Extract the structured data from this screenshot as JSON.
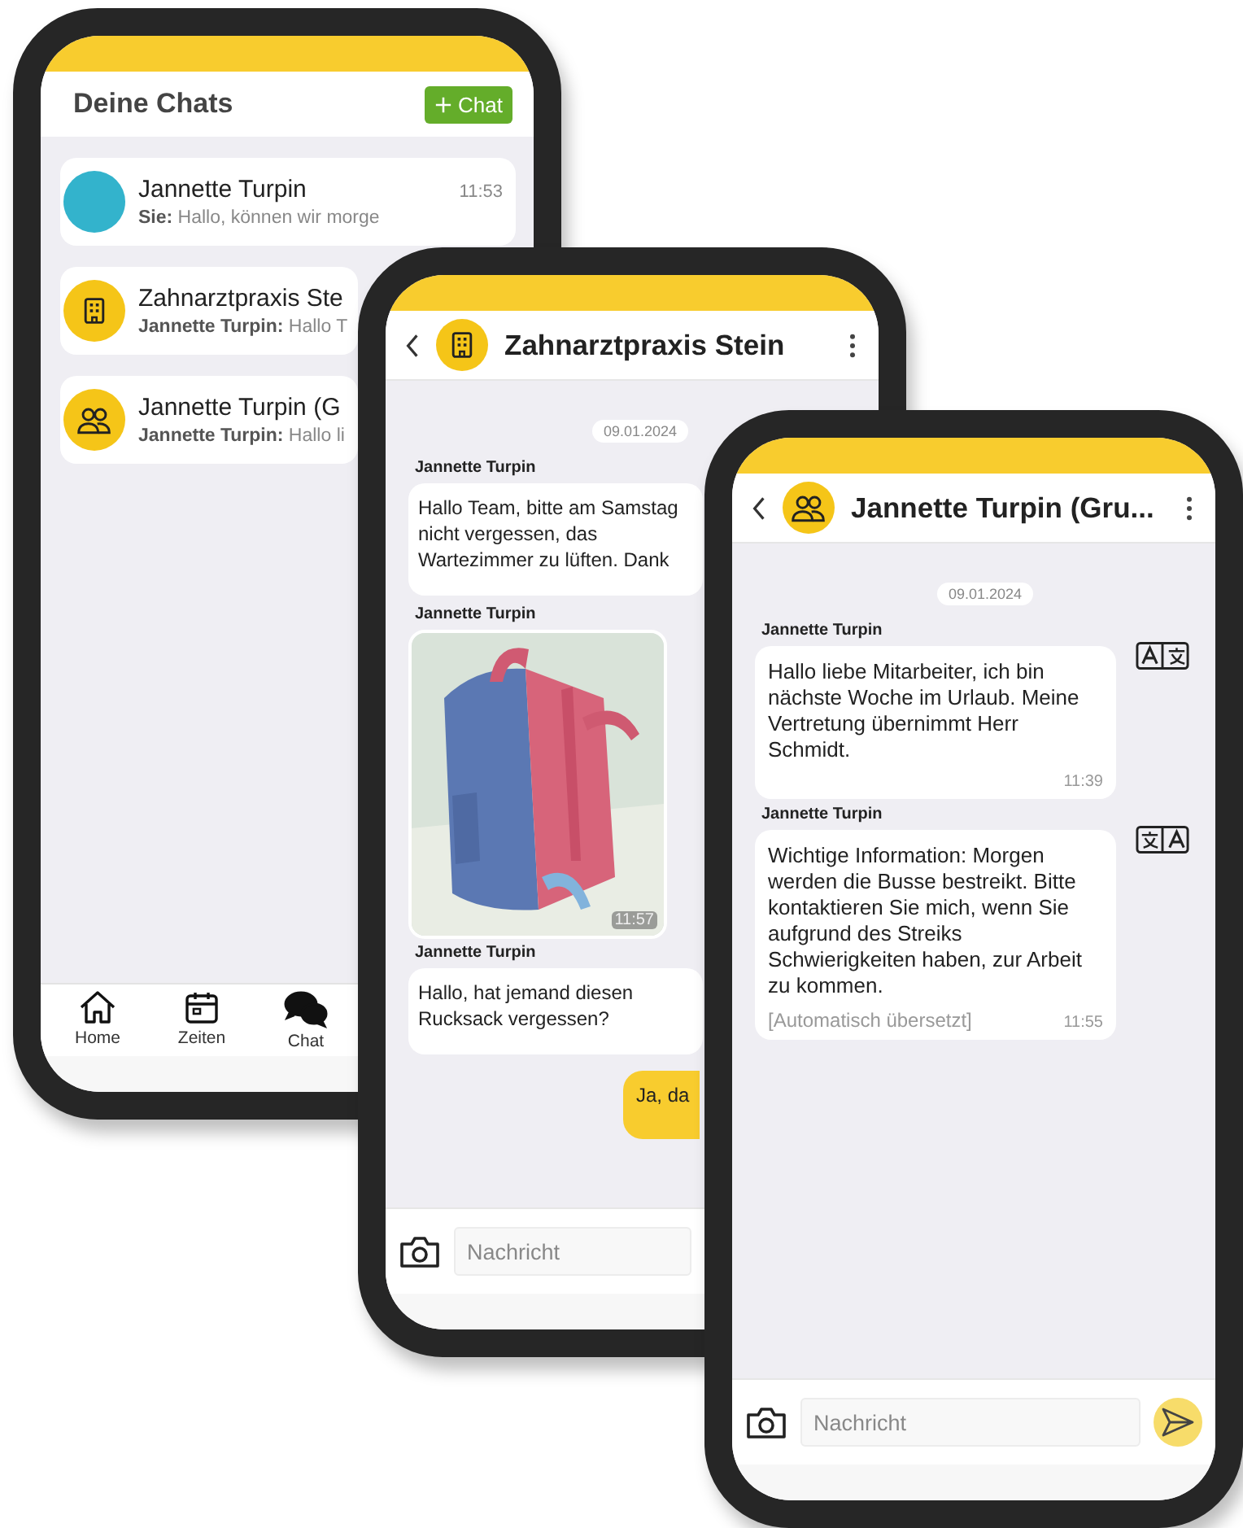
{
  "chat_list_screen": {
    "title": "Deine Chats",
    "new_chat_button": {
      "label": "Chat"
    },
    "chats": [
      {
        "kind": "person",
        "name": "Jannette Turpin",
        "time": "11:53",
        "preview": "**Sie:** Hallo, können wir morge"
      },
      {
        "kind": "building",
        "name": "Zahnarztpraxis Ste",
        "preview": "**Jannette Turpin:** Hallo T"
      },
      {
        "kind": "group",
        "name": "Jannette Turpin (G",
        "preview": "**Jannette Turpin:** Hallo li"
      }
    ],
    "nav": [
      {
        "kind": "home",
        "label": "Home",
        "selected": false
      },
      {
        "kind": "calendar",
        "label": "Zeiten",
        "selected": false
      },
      {
        "kind": "chat",
        "label": "Chat",
        "selected": true
      }
    ]
  },
  "company_chat_screen": {
    "title": "Zahnarztpraxis Stein",
    "avatar": {
      "kind": "building"
    },
    "date": "09.01.2024",
    "messages": [
      {
        "kind": "text",
        "sender": "Jannette Turpin",
        "text": "Hallo Team, bitte am Samstag\nnicht vergessen, das\nWartezimmer zu lüften. Dank"
      },
      {
        "kind": "picture",
        "sender": "Jannette Turpin",
        "time": "11:57"
      },
      {
        "kind": "text",
        "sender": "Jannette Turpin",
        "text": "Hallo, hat jemand diesen\nRucksack vergessen?"
      },
      {
        "kind": "own",
        "text": "Ja, da"
      }
    ],
    "input": {
      "placeholder": "Nachricht"
    }
  },
  "group_chat_screen": {
    "title": "Jannette Turpin (Gru...",
    "avatar": {
      "kind": "group"
    },
    "date": "09.01.2024",
    "messages": [
      {
        "sender": "Jannette Turpin",
        "text": "Hallo liebe Mitarbeiter, ich bin nächste Woche im Urlaub. Meine Vertretung übernimmt Herr Schmidt.",
        "time": "11:39",
        "translated": false
      },
      {
        "sender": "Jannette Turpin",
        "text": "Wichtige Information: Morgen werden die Busse bestreikt. Bitte kontaktieren Sie mich, wenn Sie aufgrund des Streiks Schwierigkeiten haben, zur Arbeit zu kommen.",
        "note": "[Automatisch übersetzt]",
        "time": "11:55",
        "translated": true
      }
    ],
    "input": {
      "placeholder": "Nachricht"
    }
  }
}
